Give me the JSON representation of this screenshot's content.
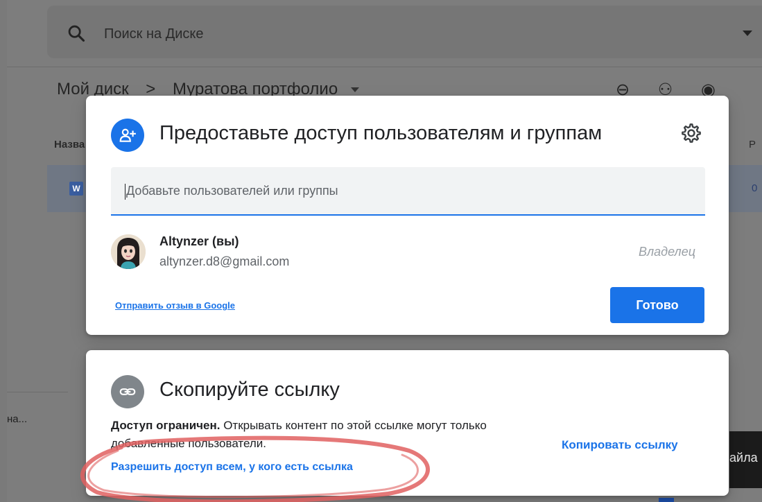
{
  "drive": {
    "search_placeholder": "Поиск на Диске",
    "breadcrumb_root": "Мой диск",
    "breadcrumb_sep": ">",
    "breadcrumb_folder": "Муратова портфолио",
    "column_name": "Назва",
    "column_right": "Р",
    "file_badge": "W",
    "row_right_text": "0",
    "side_text": "на...",
    "snackbar_text": "айла"
  },
  "share_dialog": {
    "title": "Предоставьте доступ пользователям и группам",
    "input_placeholder": "Добавьте пользователей или группы",
    "user": {
      "name": "Altynzer (вы)",
      "email": "altynzer.d8@gmail.com",
      "role": "Владелец"
    },
    "feedback_link": "Отправить отзыв в Google",
    "done_button": "Готово"
  },
  "link_dialog": {
    "title": "Скопируйте ссылку",
    "access_bold": "Доступ ограничен.",
    "access_text": " Открывать контент по этой ссылке могут только добавленные пользователи.",
    "allow_link": "Разрешить доступ всем, у кого есть ссылка",
    "copy_link": "Копировать ссылку"
  },
  "colors": {
    "accent": "#1a73e8",
    "annotation": "#e06060"
  },
  "icons": {
    "search": "search-icon",
    "person_add": "person-add-icon",
    "settings": "gear-icon",
    "link": "link-icon"
  }
}
